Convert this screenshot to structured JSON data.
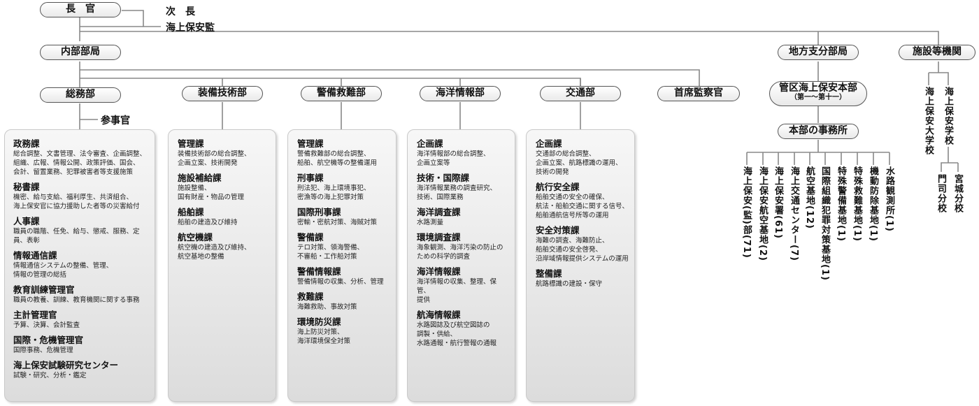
{
  "top": {
    "chief": "長　官",
    "deputy": "次　長",
    "superintendent": "海上保安監"
  },
  "internal_bureau": "内部部局",
  "regional_bureau": "地方支分部局",
  "facilities_bureau": "施設等機関",
  "departments": {
    "general": {
      "label": "総務部",
      "councilor": "参事官",
      "sections": [
        {
          "title": "政務課",
          "desc": "総合調整、文書管理、法令審査、企画調整、\n組織、広報、情報公開、政策評価、国会、\n会計、留置業務、犯罪被害者等支援施策"
        },
        {
          "title": "秘書課",
          "desc": "機密、給与支給、福利厚生、共済組合、\n海上保安官に協力援助した者等の災害給付"
        },
        {
          "title": "人事課",
          "desc": "職員の職階、任免、給与、懲戒、服務、定員、表彰"
        },
        {
          "title": "情報通信課",
          "desc": "情報通信システムの整備、管理、\n情報の管理の総括"
        },
        {
          "title": "教育訓練管理官",
          "desc": "職員の教養、訓練、教育機関に関する事務"
        },
        {
          "title": "主計管理官",
          "desc": "予算、決算、会計監査"
        },
        {
          "title": "国際・危機管理官",
          "desc": "国際事務、危機管理"
        },
        {
          "title": "海上保安試験研究センター",
          "desc": "試験・研究、分析・鑑定"
        }
      ]
    },
    "equipment": {
      "label": "装備技術部",
      "sections": [
        {
          "title": "管理課",
          "desc": "装備技術部の総合調整、\n企画立案、技術開発"
        },
        {
          "title": "施設補給課",
          "desc": "施設整備、\n国有財産・物品の管理"
        },
        {
          "title": "船舶課",
          "desc": "船舶の建造及び維持"
        },
        {
          "title": "航空機課",
          "desc": "航空機の建造及び維持、\n航空基地の整備"
        }
      ]
    },
    "guard_rescue": {
      "label": "警備救難部",
      "sections": [
        {
          "title": "管理課",
          "desc": "警備救難部の総合調整、\n船舶、航空機等の整備運用"
        },
        {
          "title": "刑事課",
          "desc": "刑法犯、海上環境事犯、\n密漁等の海上犯罪対策"
        },
        {
          "title": "国際刑事課",
          "desc": "密輸・密航対策、海賊対策"
        },
        {
          "title": "警備課",
          "desc": "テロ対策、領海警備、\n不審船・工作船対策"
        },
        {
          "title": "警備情報課",
          "desc": "警備情報の収集、分析、管理"
        },
        {
          "title": "救難課",
          "desc": "海難救助、事故対策"
        },
        {
          "title": "環境防災課",
          "desc": "海上防災対策、\n海洋環境保全対策"
        }
      ]
    },
    "hydro": {
      "label": "海洋情報部",
      "sections": [
        {
          "title": "企画課",
          "desc": "海洋情報部の総合調整、\n企画立案等"
        },
        {
          "title": "技術・国際課",
          "desc": "海洋情報業務の調査研究、\n技術、国際業務"
        },
        {
          "title": "海洋調査課",
          "desc": "水路測量"
        },
        {
          "title": "環境調査課",
          "desc": "海象観測、海洋汚染の防止の\nための科学的調査"
        },
        {
          "title": "海洋情報課",
          "desc": "海洋情報の収集、整理、保管、\n提供"
        },
        {
          "title": "航海情報課",
          "desc": "水路図誌及び航空図誌の\n調製・供給、\n水路通報・航行警報の通報"
        }
      ]
    },
    "traffic": {
      "label": "交通部",
      "sections": [
        {
          "title": "企画課",
          "desc": "交通部の総合調整、\n企画立案、航路標識の運用、\n技術の開発"
        },
        {
          "title": "航行安全課",
          "desc": "船舶交通の安全の確保、\n航法・船舶交通に関する信号、\n船舶通航信号所等の運用"
        },
        {
          "title": "安全対策課",
          "desc": "海難の調査、海難防止、\n船舶交通の安全啓発、\n沿岸域情報提供システムの運用"
        },
        {
          "title": "整備課",
          "desc": "航路標識の建設・保守"
        }
      ]
    },
    "inspector": {
      "label": "首席監察官"
    }
  },
  "regional": {
    "hq_label": "管区海上保安本部",
    "hq_sub": "（第一〜第十一）",
    "offices_label": "本部の事務所",
    "offices": [
      "海上保安(監)部(71)",
      "海上保安航空基地(2)",
      "海上保安署(61)",
      "海上交通センター(7)",
      "航空基地(12)",
      "国際組織犯罪対策基地(1)",
      "特殊警備基地(1)",
      "特殊救難基地(1)",
      "機動防除基地(1)",
      "水路観測所(1)"
    ]
  },
  "facilities": {
    "academy": "海上保安大学校",
    "school": "海上保安学校",
    "branches": [
      "門司分校",
      "宮城分校"
    ]
  }
}
